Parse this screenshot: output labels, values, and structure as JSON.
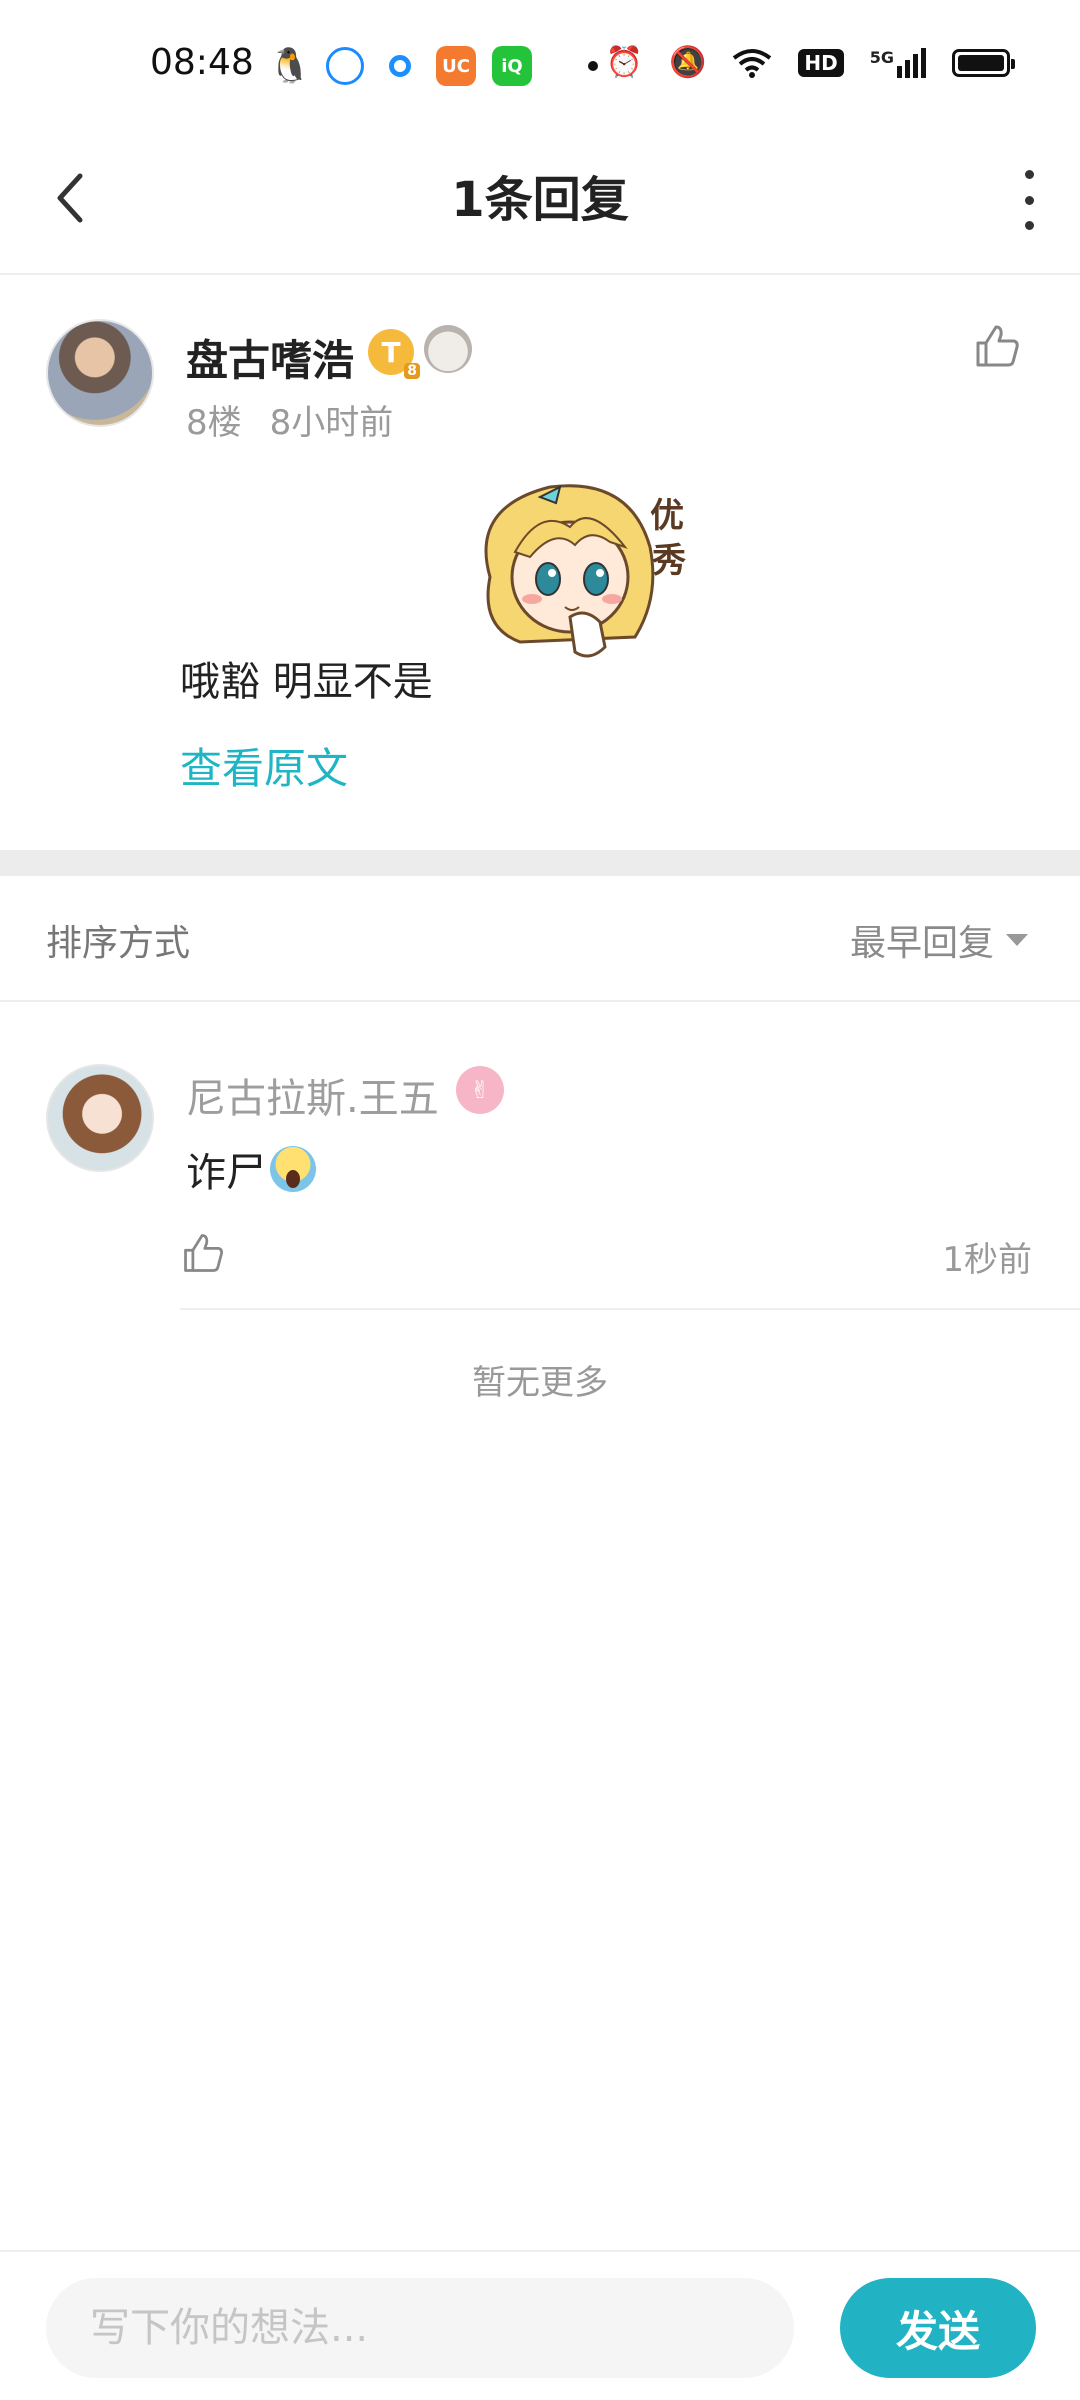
{
  "status_bar": {
    "time": "08:48",
    "apps": [
      {
        "icon": "qq-icon",
        "color": "#1ea0f5",
        "glyph": "🐧"
      },
      {
        "icon": "browser-icon",
        "color": "#ffffff",
        "glyph": "◯"
      },
      {
        "icon": "app-dot-icon",
        "color": "#1a90ff",
        "glyph": "●"
      },
      {
        "icon": "uc-browser-icon",
        "color": "#f47a30",
        "glyph": "UC"
      },
      {
        "icon": "iqiyi-icon",
        "color": "#23c43a",
        "glyph": "iQ"
      }
    ],
    "network": "5G",
    "hd": "HD"
  },
  "header": {
    "title": "1条回复"
  },
  "main_comment": {
    "username": "盘古嗜浩",
    "badge_coin": "T",
    "badge_level": "8",
    "floor": "8楼",
    "time": "8小时前",
    "sticker_text": "优秀",
    "text": "哦豁 明显不是",
    "view_original": "查看原文"
  },
  "sort": {
    "label": "排序方式",
    "selected": "最早回复"
  },
  "reply": {
    "username": "尼古拉斯.王五",
    "text": "诈尸",
    "emoji": "scream-emoji",
    "time": "1秒前"
  },
  "no_more": "暂无更多",
  "bottom": {
    "placeholder": "写下你的想法...",
    "send_label": "发送"
  },
  "colors": {
    "accent": "#1fb5c4",
    "send": "#21b3c3"
  }
}
